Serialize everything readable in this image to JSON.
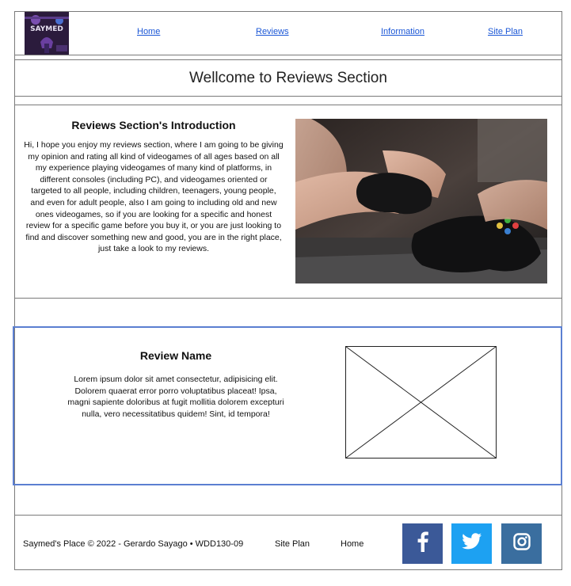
{
  "header": {
    "logo_text": "SAYMED",
    "nav": [
      {
        "label": "Home"
      },
      {
        "label": "Reviews"
      },
      {
        "label": "Information"
      },
      {
        "label": "Site Plan"
      }
    ]
  },
  "page_title": "Wellcome to Reviews Section",
  "intro": {
    "heading": "Reviews Section's Introduction",
    "text": "Hi, I hope you enjoy my reviews section, where I am going to be giving my opinion and rating all kind of videogames of all ages based on all my experience playing videogames of many kind of platforms, in different consoles (including PC), and videogames oriented or targeted to all people, including children, teenagers, young people, and even for adult people, also I am going to including old and new ones videogames, so if you are looking for a specific and honest review for a specific game before you buy it, or you are just looking to find and discover something new and good, you are in the right place, just take a look to my reviews."
  },
  "review": {
    "name": "Review Name",
    "text": "Lorem ipsum dolor sit amet consectetur, adipisicing elit. Dolorem quaerat error porro voluptatibus placeat! Ipsa, magni sapiente doloribus at fugit mollitia dolorem excepturi nulla, vero necessitatibus quidem! Sint, id tempora!"
  },
  "footer": {
    "copyright": "Saymed's Place © 2022 - Gerardo Sayago • WDD130-09",
    "links": [
      {
        "label": "Site Plan"
      },
      {
        "label": "Home"
      }
    ],
    "social": [
      {
        "icon": "facebook-icon",
        "color": "#3b5998"
      },
      {
        "icon": "twitter-icon",
        "color": "#1da1f2"
      },
      {
        "icon": "instagram-icon",
        "color": "#3a6e9f"
      }
    ]
  }
}
